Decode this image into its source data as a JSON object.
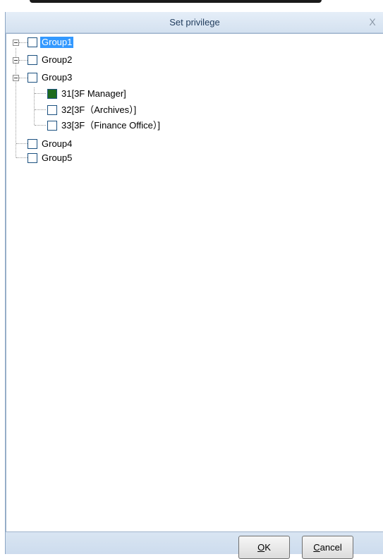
{
  "dialog": {
    "title": "Set privilege",
    "close_label": "X"
  },
  "tree": {
    "groups": [
      {
        "label": "Group1",
        "checked": false,
        "selected": true,
        "expanded": true
      },
      {
        "label": "Group2",
        "checked": false,
        "selected": false,
        "expanded": true
      },
      {
        "label": "Group3",
        "checked": false,
        "selected": false,
        "expanded": true,
        "children": [
          {
            "label": "31[3F Manager]",
            "checked": true
          },
          {
            "label": "32[3F（Archives）]",
            "checked": false
          },
          {
            "label": "33[3F（Finance Office）]",
            "checked": false
          }
        ]
      },
      {
        "label": "Group4",
        "checked": false,
        "selected": false
      },
      {
        "label": "Group5",
        "checked": false,
        "selected": false
      }
    ]
  },
  "buttons": {
    "ok_mnemonic": "O",
    "ok_rest": "K",
    "cancel_mnemonic": "C",
    "cancel_rest": "ancel"
  },
  "colors": {
    "checked_fill": "#1e6b1e",
    "selection": "#3399ff",
    "dialog_bg": "#d7e4f2"
  }
}
